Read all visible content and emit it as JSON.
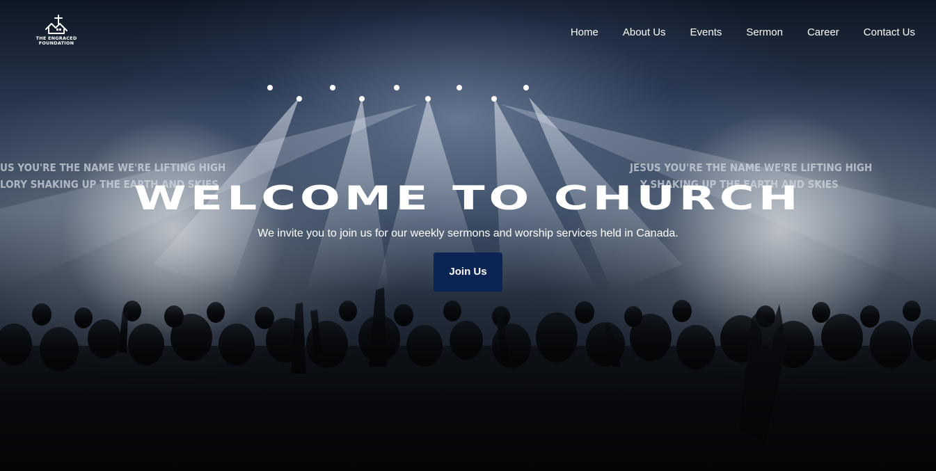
{
  "brand": {
    "logo_lines": [
      "THE ENGRACED",
      "FOUNDATION"
    ]
  },
  "nav": {
    "items": [
      {
        "label": "Home"
      },
      {
        "label": "About Us"
      },
      {
        "label": "Events"
      },
      {
        "label": "Sermon"
      },
      {
        "label": "Career"
      },
      {
        "label": "Contact Us"
      }
    ]
  },
  "hero": {
    "title": "WELCOME TO CHURCH",
    "subtitle": "We invite you to join us for our weekly sermons and worship services held in Canada.",
    "cta_label": "Join Us",
    "screen_text": {
      "left_line1": "US YOU'RE THE NAME WE'RE LIFTING HIGH",
      "left_line2": "LORY SHAKING UP THE EARTH AND SKIES",
      "right_line1": "JESUS YOU'RE THE NAME WE'RE LIFTING HIGH",
      "right_line2": "Y SHAKING UP THE EARTH AND SKIES"
    }
  },
  "colors": {
    "cta_background": "#0c2454",
    "text": "#ffffff"
  },
  "icons": {
    "logo": "cross-house-logo-icon"
  }
}
